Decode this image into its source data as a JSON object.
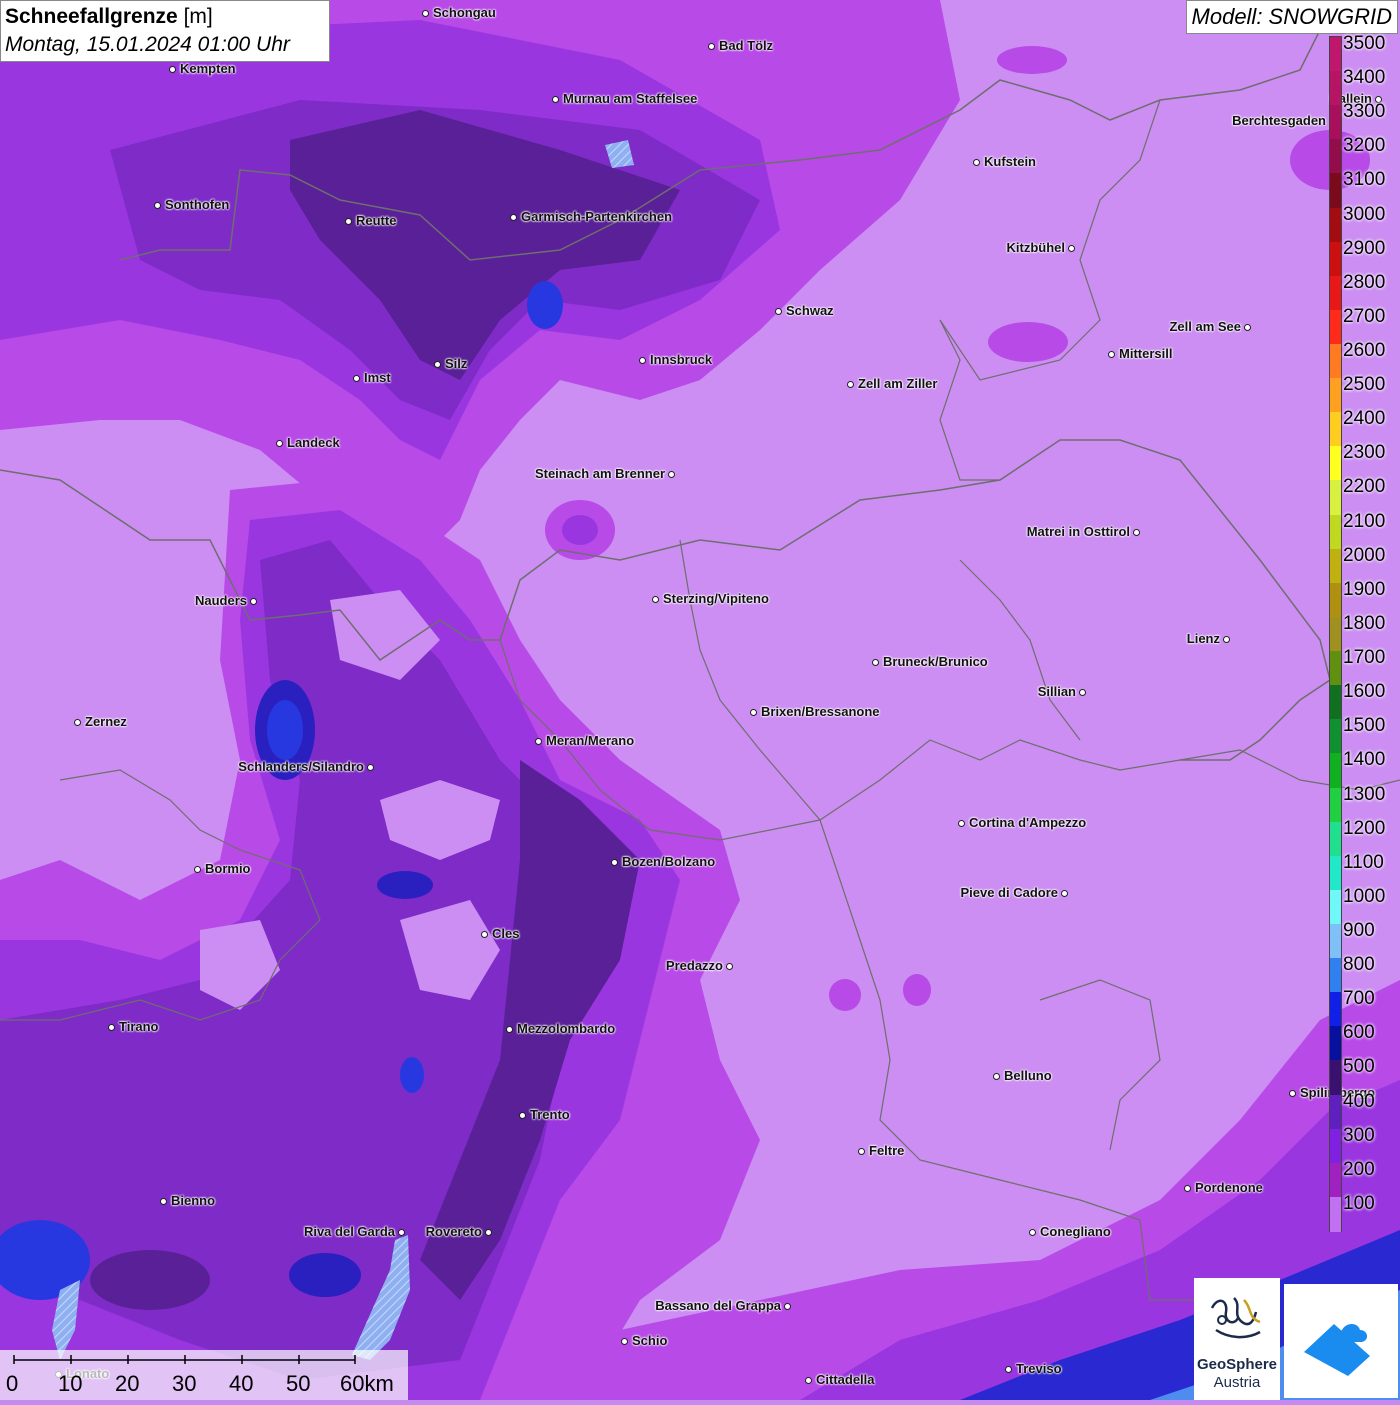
{
  "title": {
    "label": "Schneefallgrenze",
    "unit": "[m]",
    "datetime": "Montag, 15.01.2024 01:00 Uhr"
  },
  "model": "Modell: SNOWGRID",
  "legend": [
    {
      "value": "3500",
      "color": "#c0166e"
    },
    {
      "value": "3400",
      "color": "#b81465"
    },
    {
      "value": "3300",
      "color": "#a8105c"
    },
    {
      "value": "3200",
      "color": "#930c4c"
    },
    {
      "value": "3100",
      "color": "#7a0a1c"
    },
    {
      "value": "3000",
      "color": "#a30d12"
    },
    {
      "value": "2900",
      "color": "#cc1010"
    },
    {
      "value": "2800",
      "color": "#e81818"
    },
    {
      "value": "2700",
      "color": "#ff2a1a"
    },
    {
      "value": "2600",
      "color": "#ff7a20"
    },
    {
      "value": "2500",
      "color": "#ffa020"
    },
    {
      "value": "2400",
      "color": "#ffcc20"
    },
    {
      "value": "2300",
      "color": "#ffff20"
    },
    {
      "value": "2200",
      "color": "#d8f040"
    },
    {
      "value": "2100",
      "color": "#c0d820"
    },
    {
      "value": "2000",
      "color": "#c0b010"
    },
    {
      "value": "1900",
      "color": "#b09010"
    },
    {
      "value": "1800",
      "color": "#a09020"
    },
    {
      "value": "1700",
      "color": "#609010"
    },
    {
      "value": "1600",
      "color": "#107020"
    },
    {
      "value": "1500",
      "color": "#109030"
    },
    {
      "value": "1400",
      "color": "#10b020"
    },
    {
      "value": "1300",
      "color": "#20d040"
    },
    {
      "value": "1200",
      "color": "#20e090"
    },
    {
      "value": "1100",
      "color": "#20e8c8"
    },
    {
      "value": "1000",
      "color": "#70f8f8"
    },
    {
      "value": "900",
      "color": "#80c0f8"
    },
    {
      "value": "800",
      "color": "#3080f0"
    },
    {
      "value": "700",
      "color": "#1020e8"
    },
    {
      "value": "600",
      "color": "#0810a0"
    },
    {
      "value": "500",
      "color": "#3a1070"
    },
    {
      "value": "400",
      "color": "#6020c0"
    },
    {
      "value": "300",
      "color": "#8020e0"
    },
    {
      "value": "200",
      "color": "#a020c0"
    },
    {
      "value": "100",
      "color": "#c070f0"
    }
  ],
  "cities": [
    {
      "name": "Schongau"
    },
    {
      "name": "Kempten"
    },
    {
      "name": "Bad Tölz"
    },
    {
      "name": "Murnau am Staffelsee"
    },
    {
      "name": "Berchtesgaden"
    },
    {
      "name": "Hallein"
    },
    {
      "name": "Kufstein"
    },
    {
      "name": "Sonthofen"
    },
    {
      "name": "Reutte"
    },
    {
      "name": "Garmisch-Partenkirchen"
    },
    {
      "name": "Kitzbühel"
    },
    {
      "name": "Schwaz"
    },
    {
      "name": "Zell am See"
    },
    {
      "name": "Mittersill"
    },
    {
      "name": "Innsbruck"
    },
    {
      "name": "Imst"
    },
    {
      "name": "Silz"
    },
    {
      "name": "Zell am Ziller"
    },
    {
      "name": "Landeck"
    },
    {
      "name": "Steinach am Brenner"
    },
    {
      "name": "Matrei in Osttirol"
    },
    {
      "name": "Nauders"
    },
    {
      "name": "Sterzing/Vipiteno"
    },
    {
      "name": "Lienz"
    },
    {
      "name": "Bruneck/Brunico"
    },
    {
      "name": "Sillian"
    },
    {
      "name": "Zernez"
    },
    {
      "name": "Brixen/Bressanone"
    },
    {
      "name": "Meran/Merano"
    },
    {
      "name": "Schlanders/Silandro"
    },
    {
      "name": "Cortina d'Ampezzo"
    },
    {
      "name": "Bozen/Bolzano"
    },
    {
      "name": "Bormio"
    },
    {
      "name": "Pieve di Cadore"
    },
    {
      "name": "Cles"
    },
    {
      "name": "Predazzo"
    },
    {
      "name": "Tirano"
    },
    {
      "name": "Mezzolombardo"
    },
    {
      "name": "Belluno"
    },
    {
      "name": "Spilimbergo"
    },
    {
      "name": "Trento"
    },
    {
      "name": "Feltre"
    },
    {
      "name": "Pordenone"
    },
    {
      "name": "Bienno"
    },
    {
      "name": "Riva del Garda"
    },
    {
      "name": "Rovereto"
    },
    {
      "name": "Conegliano"
    },
    {
      "name": "Bassano del Grappa"
    },
    {
      "name": "Schio"
    },
    {
      "name": "Treviso"
    },
    {
      "name": "Cittadella"
    },
    {
      "name": "Lonato"
    }
  ],
  "scale": {
    "labels": [
      "0",
      "10",
      "20",
      "30",
      "40",
      "50",
      "60km"
    ]
  },
  "logos": {
    "geosphere_line1": "GeoSphere",
    "geosphere_line2": "Austria"
  }
}
